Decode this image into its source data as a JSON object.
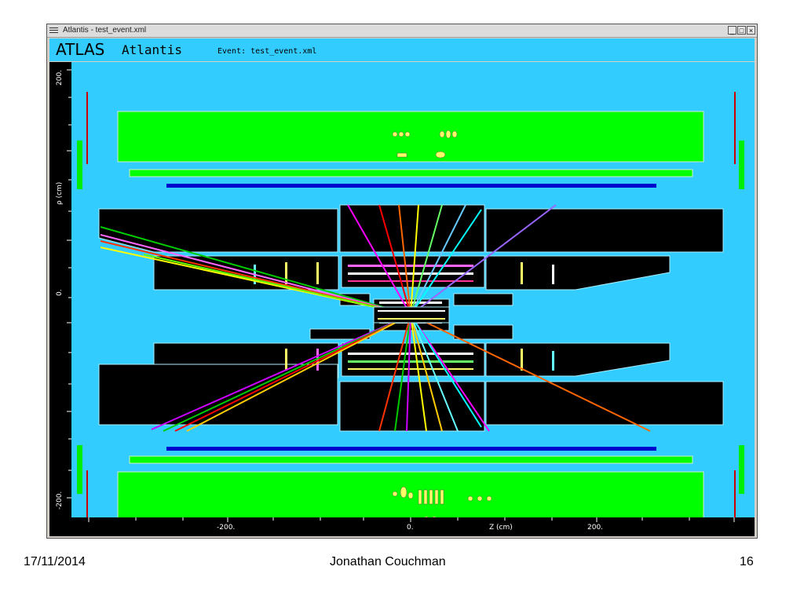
{
  "window": {
    "title": "Atlantis - test_event.xml",
    "minimize_label": "_",
    "maximize_label": "□",
    "close_label": "×"
  },
  "header": {
    "logo": "ATLAS",
    "app_name": "Atlantis",
    "event_label": "Event: test_event.xml"
  },
  "axes": {
    "y_label": "ρ (cm)",
    "y_tick_top": "200.",
    "y_tick_zero": "0.",
    "y_tick_bottom": "-200.",
    "x_label": "Z (cm)",
    "x_tick_left": "-200.",
    "x_tick_zero": "0.",
    "x_tick_right": "200."
  },
  "colors": {
    "background": "#33ccff",
    "muon_chambers": "#00ff00",
    "calorimeter": "#000000",
    "solenoid": "#0000cc"
  },
  "footer": {
    "date": "17/11/2014",
    "author": "Jonathan Couchman",
    "page": "16"
  }
}
